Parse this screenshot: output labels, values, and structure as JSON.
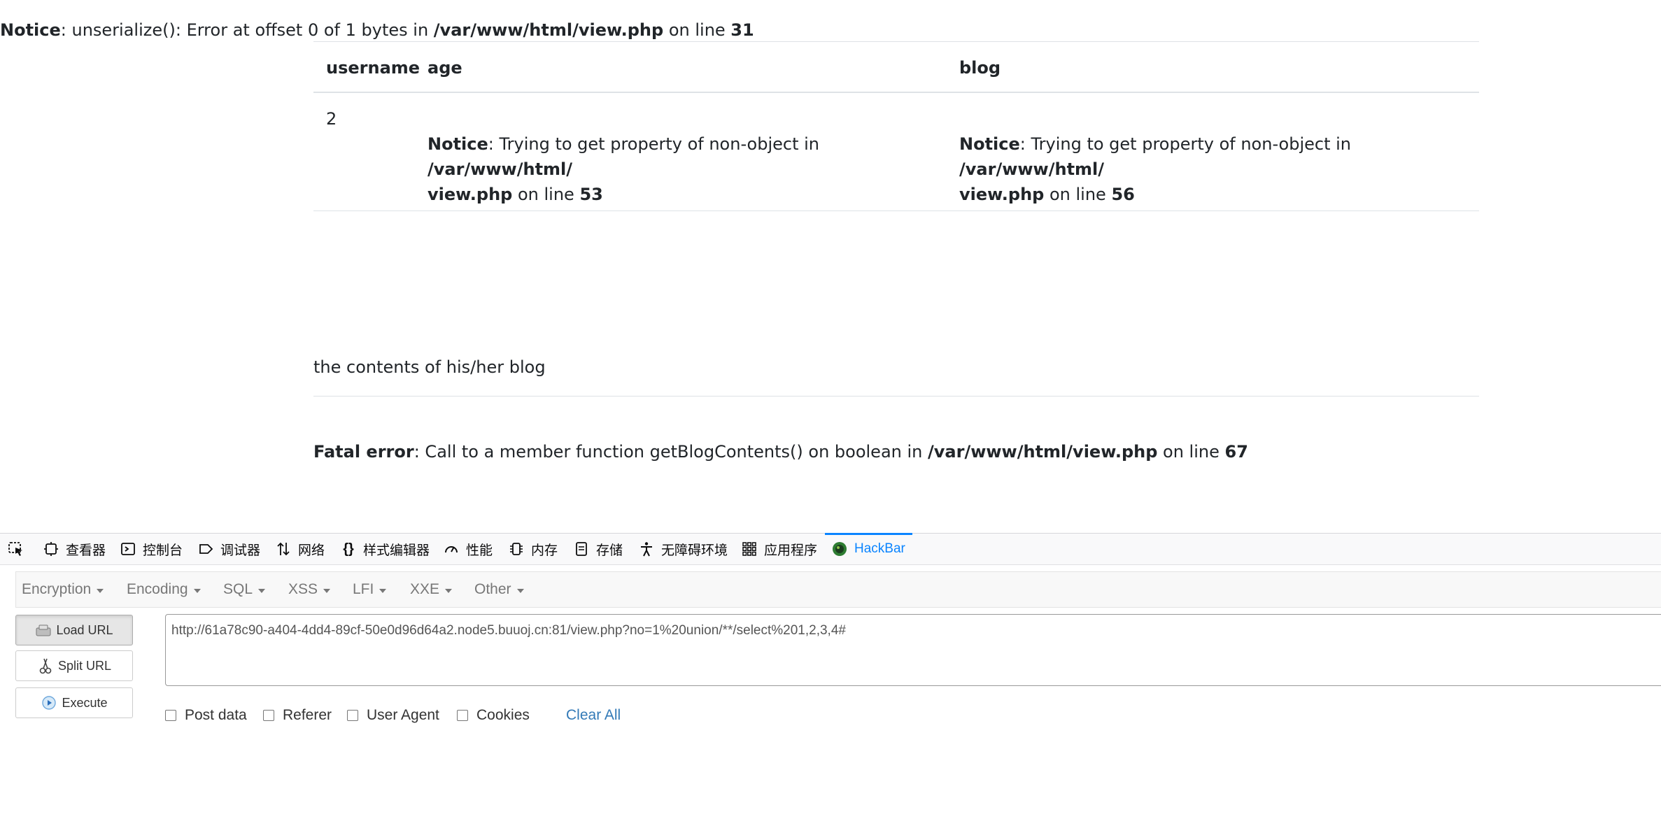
{
  "notice_top": {
    "label": "Notice",
    "text": ": unserialize(): Error at offset 0 of 1 bytes in ",
    "path": "/var/www/html/view.php",
    "on_line": " on line ",
    "line": "31"
  },
  "table": {
    "headers": {
      "username": "username",
      "age": "age",
      "blog": "blog"
    },
    "row": {
      "username": "2",
      "age": {
        "label": "Notice",
        "text": ": Trying to get property of non-object in ",
        "path1": "/var/www/html/",
        "path2": "view.php",
        "on_line": " on line ",
        "line": "53"
      },
      "blog": {
        "label": "Notice",
        "text": ": Trying to get property of non-object in ",
        "path1": "/var/www/html/",
        "path2": "view.php",
        "on_line": " on line ",
        "line": "56"
      }
    }
  },
  "blog_contents": "the contents of his/her blog",
  "fatal": {
    "label": "Fatal error",
    "text": ": Call to a member function getBlogContents() on boolean in ",
    "path": "/var/www/html/view.php",
    "on_line": " on line ",
    "line": "67"
  },
  "devtools": {
    "tabs": [
      {
        "label": "查看器",
        "icon": "inspector-icon"
      },
      {
        "label": "控制台",
        "icon": "console-icon"
      },
      {
        "label": "调试器",
        "icon": "debugger-icon"
      },
      {
        "label": "网络",
        "icon": "network-icon"
      },
      {
        "label": "样式编辑器",
        "icon": "style-editor-icon"
      },
      {
        "label": "性能",
        "icon": "performance-icon"
      },
      {
        "label": "内存",
        "icon": "memory-icon"
      },
      {
        "label": "存储",
        "icon": "storage-icon"
      },
      {
        "label": "无障碍环境",
        "icon": "accessibility-icon"
      },
      {
        "label": "应用程序",
        "icon": "application-icon"
      },
      {
        "label": "HackBar",
        "icon": "hackbar-icon"
      }
    ],
    "active_tab": "HackBar"
  },
  "hackbar": {
    "menus": [
      "Encryption",
      "Encoding",
      "SQL",
      "XSS",
      "LFI",
      "XXE",
      "Other"
    ],
    "buttons": {
      "load_url": "Load URL",
      "split_url": "Split URL",
      "execute": "Execute"
    },
    "url": "http://61a78c90-a404-4dd4-89cf-50e0d96d64a2.node5.buuoj.cn:81/view.php?no=1%20union/**/select%201,2,3,4#",
    "options": {
      "post_data": "Post data",
      "referer": "Referer",
      "user_agent": "User Agent",
      "cookies": "Cookies"
    },
    "clear_all": "Clear All"
  },
  "colors": {
    "accent": "#0a84ff",
    "link": "#337ab7",
    "hackbar_menu": "#777777"
  }
}
